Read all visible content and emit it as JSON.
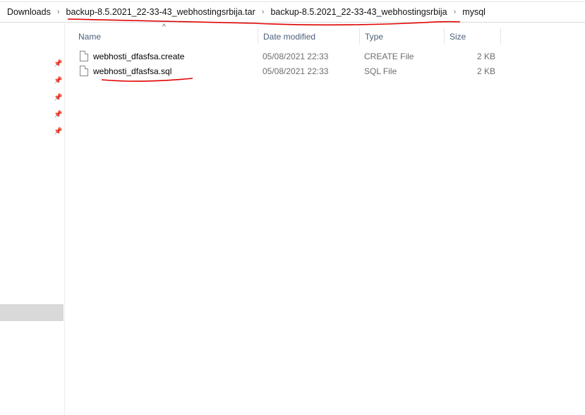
{
  "breadcrumb": [
    "Downloads",
    "backup-8.5.2021_22-33-43_webhostingsrbija.tar",
    "backup-8.5.2021_22-33-43_webhostingsrbija",
    "mysql"
  ],
  "columns": {
    "name": "Name",
    "date": "Date modified",
    "type": "Type",
    "size": "Size"
  },
  "files": [
    {
      "name": "webhosti_dfasfsa.create",
      "date": "05/08/2021 22:33",
      "type": "CREATE File",
      "size": "2 KB"
    },
    {
      "name": "webhosti_dfasfsa.sql",
      "date": "05/08/2021 22:33",
      "type": "SQL File",
      "size": "2 KB"
    }
  ],
  "annotation_color": "#e00000"
}
